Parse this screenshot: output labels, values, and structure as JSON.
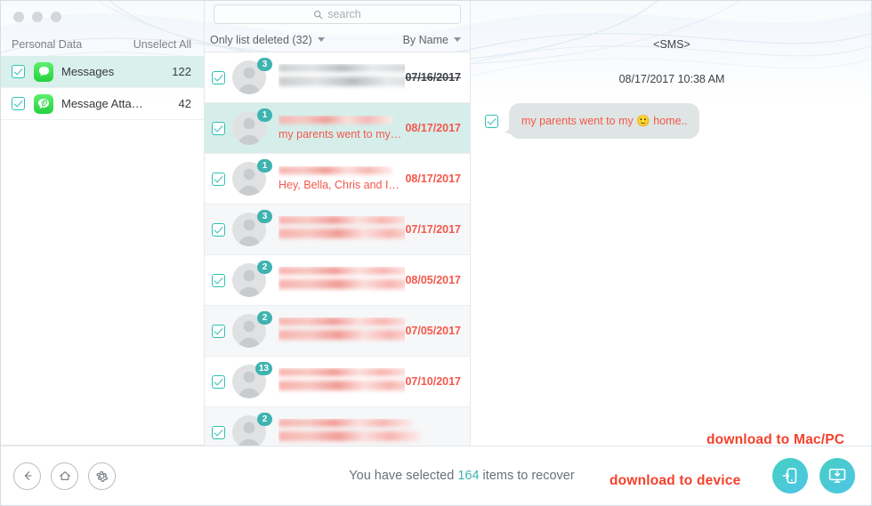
{
  "window": {
    "dots": [
      "close",
      "minimize",
      "zoom"
    ]
  },
  "sidebar": {
    "header": {
      "title": "Personal Data",
      "unselect_label": "Unselect All"
    },
    "items": [
      {
        "label": "Messages",
        "count": "122",
        "icon": "messages-icon",
        "checked": true,
        "active": true
      },
      {
        "label": "Message Atta…",
        "count": "42",
        "icon": "message-attachment-icon",
        "checked": true,
        "active": false
      }
    ]
  },
  "search": {
    "placeholder": "search",
    "icon": "search-icon"
  },
  "filterbar": {
    "filter_label": "Only list deleted (32)",
    "sort_label": "By Name"
  },
  "list": {
    "rows": [
      {
        "badge": "3",
        "preview": "",
        "date": "07/16/2017",
        "struck": true,
        "selected": false,
        "alt": false,
        "blurred_preview": true
      },
      {
        "badge": "1",
        "preview": "my parents went to my…",
        "date": "08/17/2017",
        "struck": false,
        "selected": true,
        "alt": false,
        "blurred_preview": false
      },
      {
        "badge": "1",
        "preview": "Hey, Bella, Chris and I…",
        "date": "08/17/2017",
        "struck": false,
        "selected": false,
        "alt": false,
        "blurred_preview": false
      },
      {
        "badge": "3",
        "preview": "",
        "date": "07/17/2017",
        "struck": false,
        "selected": false,
        "alt": true,
        "blurred_preview": true
      },
      {
        "badge": "2",
        "preview": "",
        "date": "08/05/2017",
        "struck": false,
        "selected": false,
        "alt": false,
        "blurred_preview": true
      },
      {
        "badge": "2",
        "preview": "",
        "date": "07/05/2017",
        "struck": false,
        "selected": false,
        "alt": true,
        "blurred_preview": true
      },
      {
        "badge": "13",
        "preview": "",
        "date": "07/10/2017",
        "struck": false,
        "selected": false,
        "alt": false,
        "blurred_preview": true
      },
      {
        "badge": "2",
        "preview": "",
        "date": "",
        "struck": false,
        "selected": false,
        "alt": true,
        "blurred_preview": true
      }
    ]
  },
  "sms": {
    "title": "<SMS>",
    "timestamp": "08/17/2017 10:38 AM",
    "message": "my parents went to my 🙂 home..",
    "checked": true
  },
  "bottom": {
    "nav": [
      {
        "name": "back-button",
        "icon": "arrow-left-icon"
      },
      {
        "name": "home-button",
        "icon": "home-icon"
      },
      {
        "name": "settings-button",
        "icon": "gear-icon"
      }
    ],
    "status_prefix": "You have selected",
    "status_count": "164",
    "status_suffix": "items to recover",
    "buttons": [
      {
        "name": "download-to-device-button",
        "icon": "phone-download-icon"
      },
      {
        "name": "download-to-computer-button",
        "icon": "monitor-download-icon"
      }
    ]
  },
  "annotations": {
    "mac_pc": "download to Mac/PC",
    "device": "download to device"
  },
  "colors": {
    "accent_teal": "#3fb3b0",
    "deleted_red": "#f4584c",
    "annotation_red": "#f4402c",
    "selected_row": "#d6eeea"
  }
}
